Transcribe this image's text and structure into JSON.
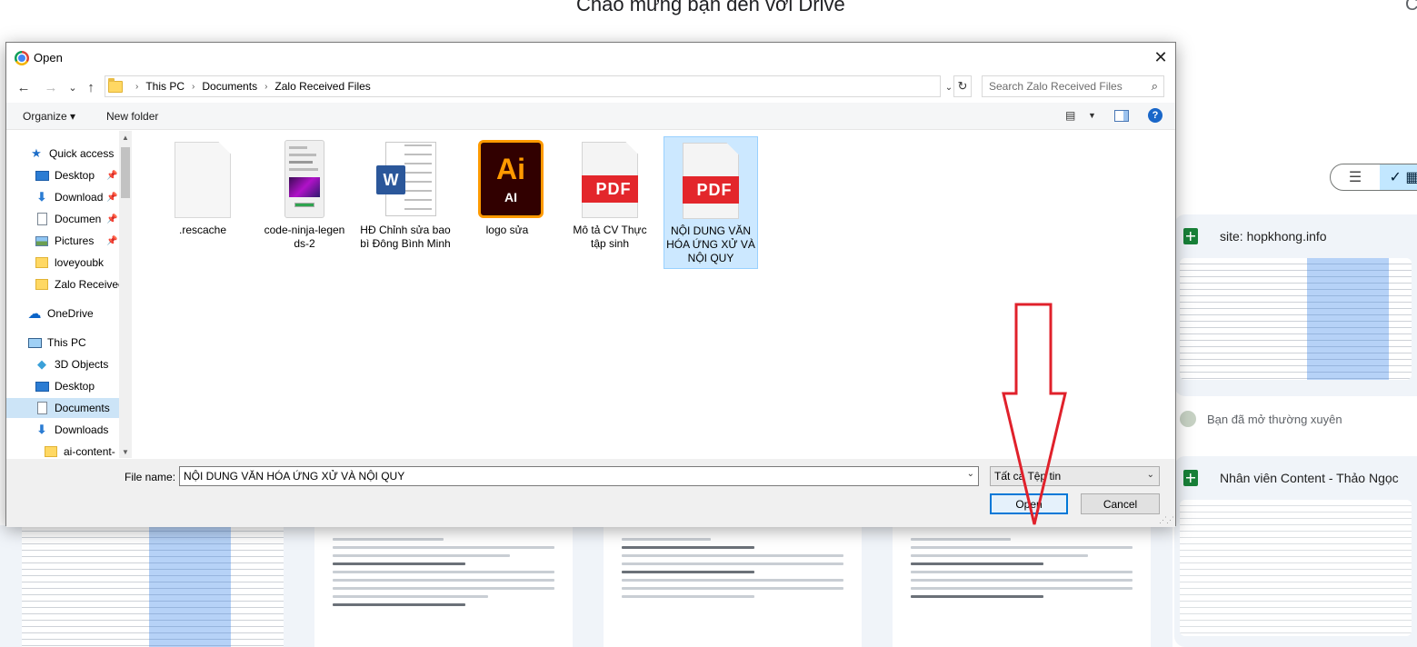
{
  "background": {
    "drive_title": "Chào mừng bạn đến với Drive",
    "side_cards": [
      {
        "title": "site: hopkhong.info"
      },
      {
        "title": "Nhân viên Content - Thảo Ngọc"
      }
    ],
    "frequent_label": "Bạn đã mở thường xuyên",
    "view_toggle": {
      "list_icon": "☰",
      "grid_icon": "✓ ▦"
    }
  },
  "dialog": {
    "title": "Open",
    "close_glyph": "✕",
    "nav": {
      "back": "←",
      "forward": "→",
      "recent": "⌄",
      "up": "↑"
    },
    "breadcrumbs": [
      "This PC",
      "Documents",
      "Zalo Received Files"
    ],
    "search_placeholder": "Search Zalo Received Files",
    "toolbar": {
      "organize": "Organize ▾",
      "new_folder": "New folder",
      "help": "?"
    },
    "nav_pane": [
      {
        "label": "Quick access",
        "icon": "star-icon",
        "pinned": false,
        "indent": 0
      },
      {
        "label": "Desktop",
        "icon": "desktop-icon",
        "pinned": true,
        "indent": 1
      },
      {
        "label": "Download",
        "icon": "download-icon",
        "pinned": true,
        "indent": 1
      },
      {
        "label": "Documen",
        "icon": "document-icon",
        "pinned": true,
        "indent": 1
      },
      {
        "label": "Pictures",
        "icon": "pictures-icon",
        "pinned": true,
        "indent": 1
      },
      {
        "label": "loveyoubk",
        "icon": "folder-icon",
        "pinned": false,
        "indent": 1
      },
      {
        "label": "Zalo Receivec",
        "icon": "folder-icon",
        "pinned": false,
        "indent": 1
      },
      {
        "label": "OneDrive",
        "icon": "cloud-icon",
        "pinned": false,
        "indent": 0
      },
      {
        "label": "This PC",
        "icon": "computer-icon",
        "pinned": false,
        "indent": 0
      },
      {
        "label": "3D Objects",
        "icon": "cube-icon",
        "pinned": false,
        "indent": 1
      },
      {
        "label": "Desktop",
        "icon": "desktop-icon",
        "pinned": false,
        "indent": 1
      },
      {
        "label": "Documents",
        "icon": "document-icon",
        "pinned": false,
        "indent": 1
      },
      {
        "label": "Downloads",
        "icon": "download-icon",
        "pinned": false,
        "indent": 1
      },
      {
        "label": "ai-content-",
        "icon": "folder-icon",
        "pinned": false,
        "indent": 2
      }
    ],
    "files": [
      {
        "name": ".rescache",
        "type": "blank"
      },
      {
        "name": "code-ninja-legen ds-2",
        "type": "image"
      },
      {
        "name": "HĐ Chỉnh sửa bao bì Đông Bình Minh",
        "type": "word"
      },
      {
        "name": "logo sửa",
        "type": "illustrator"
      },
      {
        "name": "Mô tả CV Thực tập sinh",
        "type": "pdf"
      },
      {
        "name": "NỘI DUNG VĂN HÓA ỨNG XỬ VÀ NỘI QUY",
        "type": "pdf"
      }
    ],
    "selected_file": "NỘI DUNG VĂN HÓA ỨNG XỬ VÀ NỘI QUY",
    "icon_text": {
      "word": "W",
      "ai_big": "Ai",
      "ai_small": "AI",
      "pdf": "PDF"
    },
    "footer": {
      "file_name_label": "File name:",
      "file_name_value": "NỘI DUNG VĂN HÓA ỨNG XỬ VÀ NỘI QUY",
      "file_type": "Tất cả Tệp tin",
      "open_button": "Open",
      "cancel_button": "Cancel"
    }
  },
  "colors": {
    "annotation_arrow": "#e0212b",
    "selection": "#cce8ff",
    "accent": "#0078d7"
  }
}
